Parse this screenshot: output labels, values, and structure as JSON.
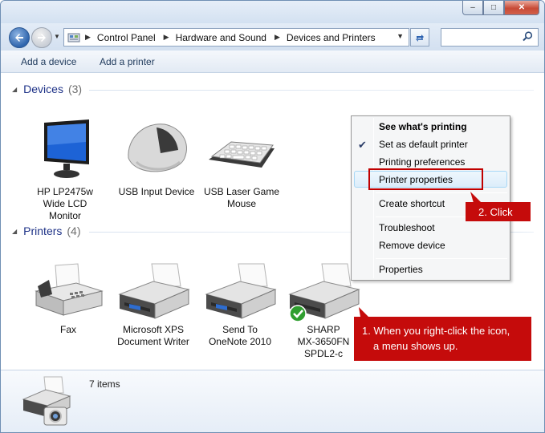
{
  "window": {
    "buttons": {
      "minimize": "–",
      "maximize": "□",
      "close": "✕"
    }
  },
  "address_bar": {
    "breadcrumbs": [
      "Control Panel",
      "Hardware and Sound",
      "Devices and Printers"
    ],
    "search_placeholder": ""
  },
  "command_bar": {
    "add_device": "Add a device",
    "add_printer": "Add a printer"
  },
  "devices_group": {
    "title": "Devices",
    "count": "(3)",
    "items": [
      {
        "label_lines": [
          "HP LP2475w",
          "Wide LCD",
          "Monitor"
        ],
        "icon": "monitor-icon"
      },
      {
        "label_lines": [
          "USB Input Device"
        ],
        "icon": "mouse-icon"
      },
      {
        "label_lines": [
          "USB Laser Game",
          "Mouse"
        ],
        "icon": "keyboard-icon"
      }
    ]
  },
  "printers_group": {
    "title": "Printers",
    "count": "(4)",
    "items": [
      {
        "label_lines": [
          "Fax"
        ],
        "icon": "fax-icon"
      },
      {
        "label_lines": [
          "Microsoft XPS",
          "Document Writer"
        ],
        "icon": "printer-icon"
      },
      {
        "label_lines": [
          "Send To",
          "OneNote 2010"
        ],
        "icon": "printer-icon"
      },
      {
        "label_lines": [
          "SHARP",
          "MX-3650FN",
          "SPDL2-c"
        ],
        "icon": "printer-default-icon"
      }
    ]
  },
  "context_menu": {
    "items": [
      {
        "label": "See what's printing",
        "bold": true
      },
      {
        "label": "Set as default printer",
        "checked": true
      },
      {
        "label": "Printing preferences"
      },
      {
        "label": "Printer properties",
        "highlighted": true
      },
      {
        "label": "Create shortcut"
      },
      {
        "label": "Troubleshoot"
      },
      {
        "label": "Remove device"
      },
      {
        "label": "Properties"
      }
    ]
  },
  "callouts": {
    "step1": [
      "1. When you right-click the icon,",
      "a menu shows up."
    ],
    "step2": "2. Click",
    "color": "#c50b0b"
  },
  "details_pane": {
    "count": "7 items"
  },
  "colors": {
    "group_header": "#1e3287",
    "accent": "#2f65ad",
    "highlight_box": "#c00000"
  }
}
